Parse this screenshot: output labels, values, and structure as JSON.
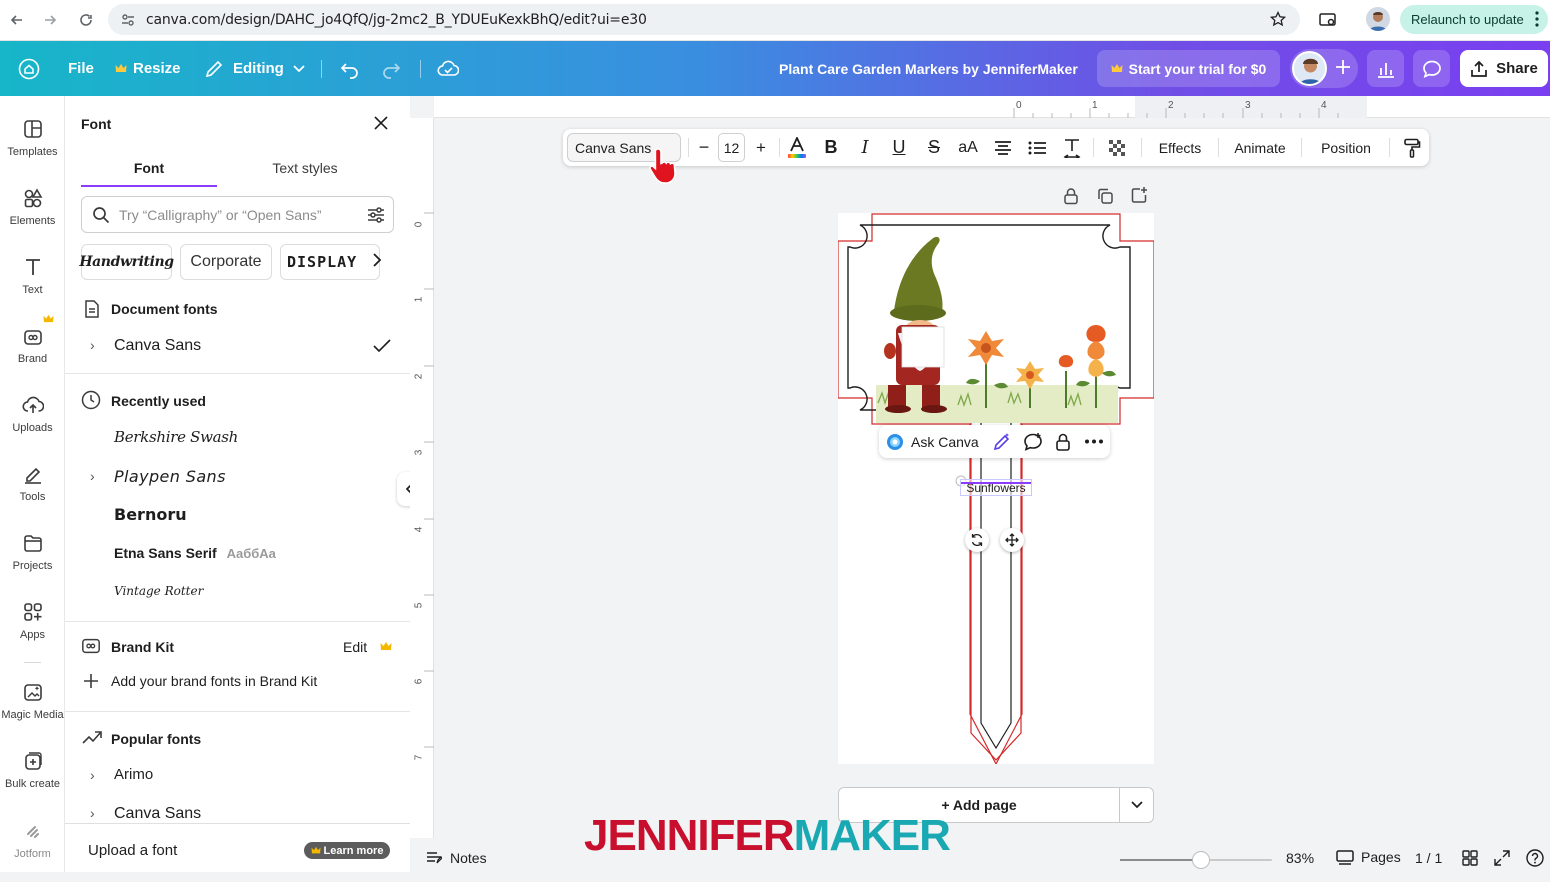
{
  "browser": {
    "url": "canva.com/design/DAHC_jo4QfQ/jg-2mc2_B_YDUEuKexkBhQ/edit?ui=e30",
    "relaunch_label": "Relaunch to update"
  },
  "topbar": {
    "file_label": "File",
    "resize_label": "Resize",
    "editing_label": "Editing",
    "design_title": "Plant Care Garden Markers by JenniferMaker",
    "trial_label": "Start your trial for $0",
    "share_label": "Share"
  },
  "rail": {
    "items": [
      {
        "label": "Templates",
        "icon": "templates-icon"
      },
      {
        "label": "Elements",
        "icon": "elements-icon"
      },
      {
        "label": "Text",
        "icon": "text-icon"
      },
      {
        "label": "Brand",
        "icon": "brand-icon"
      },
      {
        "label": "Uploads",
        "icon": "uploads-icon"
      },
      {
        "label": "Tools",
        "icon": "tools-icon"
      },
      {
        "label": "Projects",
        "icon": "projects-icon"
      },
      {
        "label": "Apps",
        "icon": "apps-icon"
      },
      {
        "label": "Magic Media",
        "icon": "magic-media-icon"
      },
      {
        "label": "Bulk create",
        "icon": "bulk-create-icon"
      },
      {
        "label": "Jotform",
        "icon": "jotform-icon"
      }
    ]
  },
  "panel": {
    "title": "Font",
    "tabs": [
      "Font",
      "Text styles"
    ],
    "search_placeholder": "Try “Calligraphy” or “Open Sans”",
    "chips": [
      "Handwriting",
      "Corporate",
      "DISPLAY"
    ],
    "document_fonts": {
      "title": "Document fonts",
      "items": [
        "Canva Sans"
      ]
    },
    "recently_used": {
      "title": "Recently used",
      "items": [
        "Berkshire Swash",
        "Playpen Sans",
        "Bernoru",
        "Etna Sans Serif",
        "Vintage Rotter"
      ],
      "etna_preview": "AaббAa"
    },
    "brand_kit": {
      "title": "Brand Kit",
      "edit_label": "Edit",
      "add_label": "Add your brand fonts in Brand Kit"
    },
    "popular": {
      "title": "Popular fonts",
      "items": [
        "Arimo",
        "Canva Sans"
      ]
    },
    "upload_label": "Upload a font",
    "learn_more_label": "Learn more"
  },
  "toolbar": {
    "font_name": "Canva Sans",
    "font_size": "12",
    "effects_label": "Effects",
    "animate_label": "Animate",
    "position_label": "Position",
    "case_label": "aA"
  },
  "ruler": {
    "top": [
      "0",
      "1",
      "2",
      "3",
      "4"
    ],
    "left": [
      "0",
      "1",
      "2",
      "3",
      "4",
      "5",
      "6",
      "7"
    ]
  },
  "canvas": {
    "ask_canva_label": "Ask Canva",
    "text_element": "Sunflowers",
    "add_page_label": "+ Add page"
  },
  "bottombar": {
    "notes_label": "Notes",
    "zoom_value": "83%",
    "zoom_fraction": 0.53,
    "pages_label": "Pages",
    "page_count": "1 / 1"
  },
  "watermark": {
    "part1": "JENNIFER",
    "part2": "MAKER"
  },
  "colors": {
    "accent": "#8b3dff",
    "red": "#c8102e",
    "teal": "#1aa9b3",
    "brand_crown": "#f5b700"
  }
}
